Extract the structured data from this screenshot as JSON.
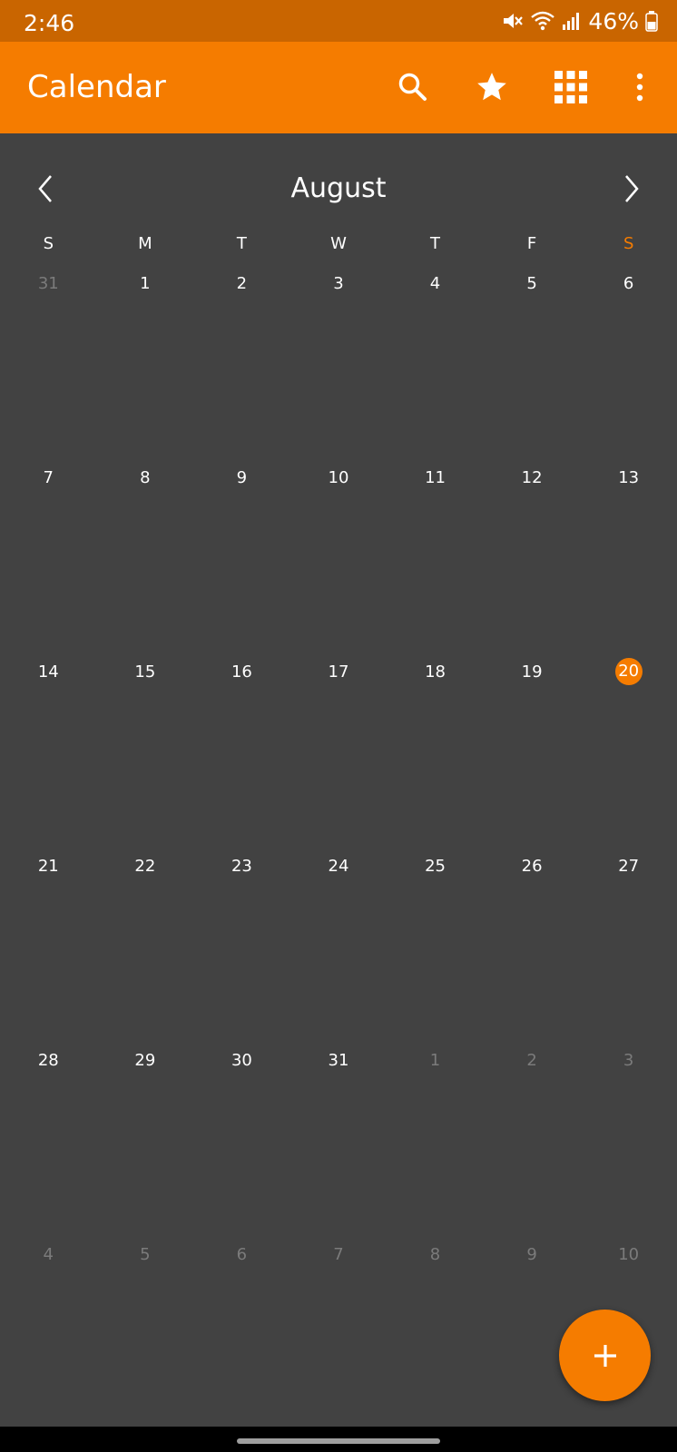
{
  "status_bar": {
    "time": "2:46",
    "battery": "46%",
    "icons": [
      "mute-icon",
      "wifi-icon",
      "signal-icon",
      "battery-icon"
    ]
  },
  "app_bar": {
    "title": "Calendar",
    "actions": [
      "search-icon",
      "star-icon",
      "grid-icon",
      "more-vert-icon"
    ]
  },
  "calendar": {
    "month": "August",
    "weekdays": [
      "S",
      "M",
      "T",
      "W",
      "T",
      "F",
      "S"
    ],
    "weeks": [
      [
        {
          "day": "31",
          "current": false
        },
        {
          "day": "1",
          "current": true
        },
        {
          "day": "2",
          "current": true
        },
        {
          "day": "3",
          "current": true
        },
        {
          "day": "4",
          "current": true
        },
        {
          "day": "5",
          "current": true
        },
        {
          "day": "6",
          "current": true
        }
      ],
      [
        {
          "day": "7",
          "current": true
        },
        {
          "day": "8",
          "current": true
        },
        {
          "day": "9",
          "current": true
        },
        {
          "day": "10",
          "current": true
        },
        {
          "day": "11",
          "current": true
        },
        {
          "day": "12",
          "current": true
        },
        {
          "day": "13",
          "current": true
        }
      ],
      [
        {
          "day": "14",
          "current": true
        },
        {
          "day": "15",
          "current": true
        },
        {
          "day": "16",
          "current": true
        },
        {
          "day": "17",
          "current": true
        },
        {
          "day": "18",
          "current": true
        },
        {
          "day": "19",
          "current": true
        },
        {
          "day": "20",
          "current": true,
          "today": true
        }
      ],
      [
        {
          "day": "21",
          "current": true
        },
        {
          "day": "22",
          "current": true
        },
        {
          "day": "23",
          "current": true
        },
        {
          "day": "24",
          "current": true
        },
        {
          "day": "25",
          "current": true
        },
        {
          "day": "26",
          "current": true
        },
        {
          "day": "27",
          "current": true
        }
      ],
      [
        {
          "day": "28",
          "current": true
        },
        {
          "day": "29",
          "current": true
        },
        {
          "day": "30",
          "current": true
        },
        {
          "day": "31",
          "current": true
        },
        {
          "day": "1",
          "current": false
        },
        {
          "day": "2",
          "current": false
        },
        {
          "day": "3",
          "current": false
        }
      ],
      [
        {
          "day": "4",
          "current": false
        },
        {
          "day": "5",
          "current": false
        },
        {
          "day": "6",
          "current": false
        },
        {
          "day": "7",
          "current": false
        },
        {
          "day": "8",
          "current": false
        },
        {
          "day": "9",
          "current": false
        },
        {
          "day": "10",
          "current": false
        }
      ]
    ]
  },
  "fab": {
    "icon": "plus-icon"
  },
  "colors": {
    "accent": "#f57c00",
    "status_bar": "#c96500",
    "background": "#424242",
    "text": "#ffffff",
    "muted_text": "#7b7b7b"
  }
}
